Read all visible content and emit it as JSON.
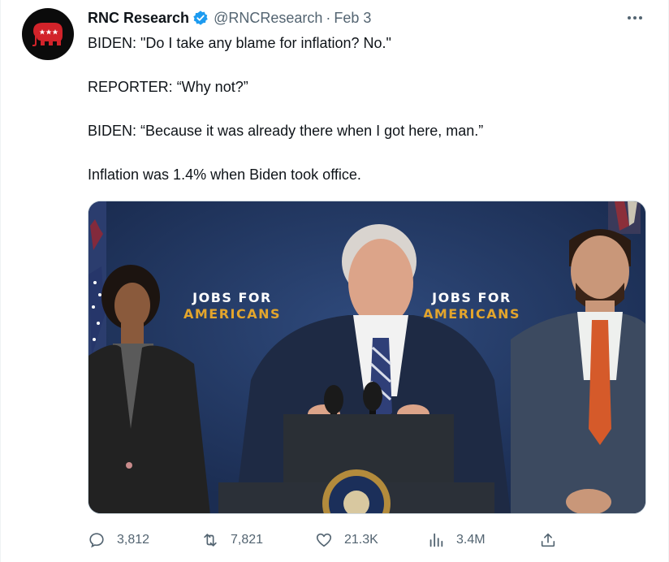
{
  "tweet": {
    "author_name": "RNC Research",
    "handle": "@RNCResearch",
    "separator": "·",
    "date": "Feb 3",
    "lines": [
      "BIDEN: \"Do I take any blame for inflation? No.\"",
      "REPORTER: “Why not?”",
      "BIDEN: “Because it was already there when I got here, man.”",
      "Inflation was 1.4% when Biden took office."
    ]
  },
  "media": {
    "banner_left": [
      "JOBS FOR",
      "AMERICANS"
    ],
    "banner_right": [
      "JOBS FOR",
      "AMERICANS"
    ],
    "seal_text": "PRESIDENT OF THE UNITED"
  },
  "actions": {
    "replies": "3,812",
    "retweets": "7,821",
    "likes": "21.3K",
    "views": "3.4M"
  },
  "colors": {
    "text": "#0f1419",
    "secondary": "#536471",
    "verified": "#1d9bf0",
    "rnc_red": "#d2232a"
  }
}
